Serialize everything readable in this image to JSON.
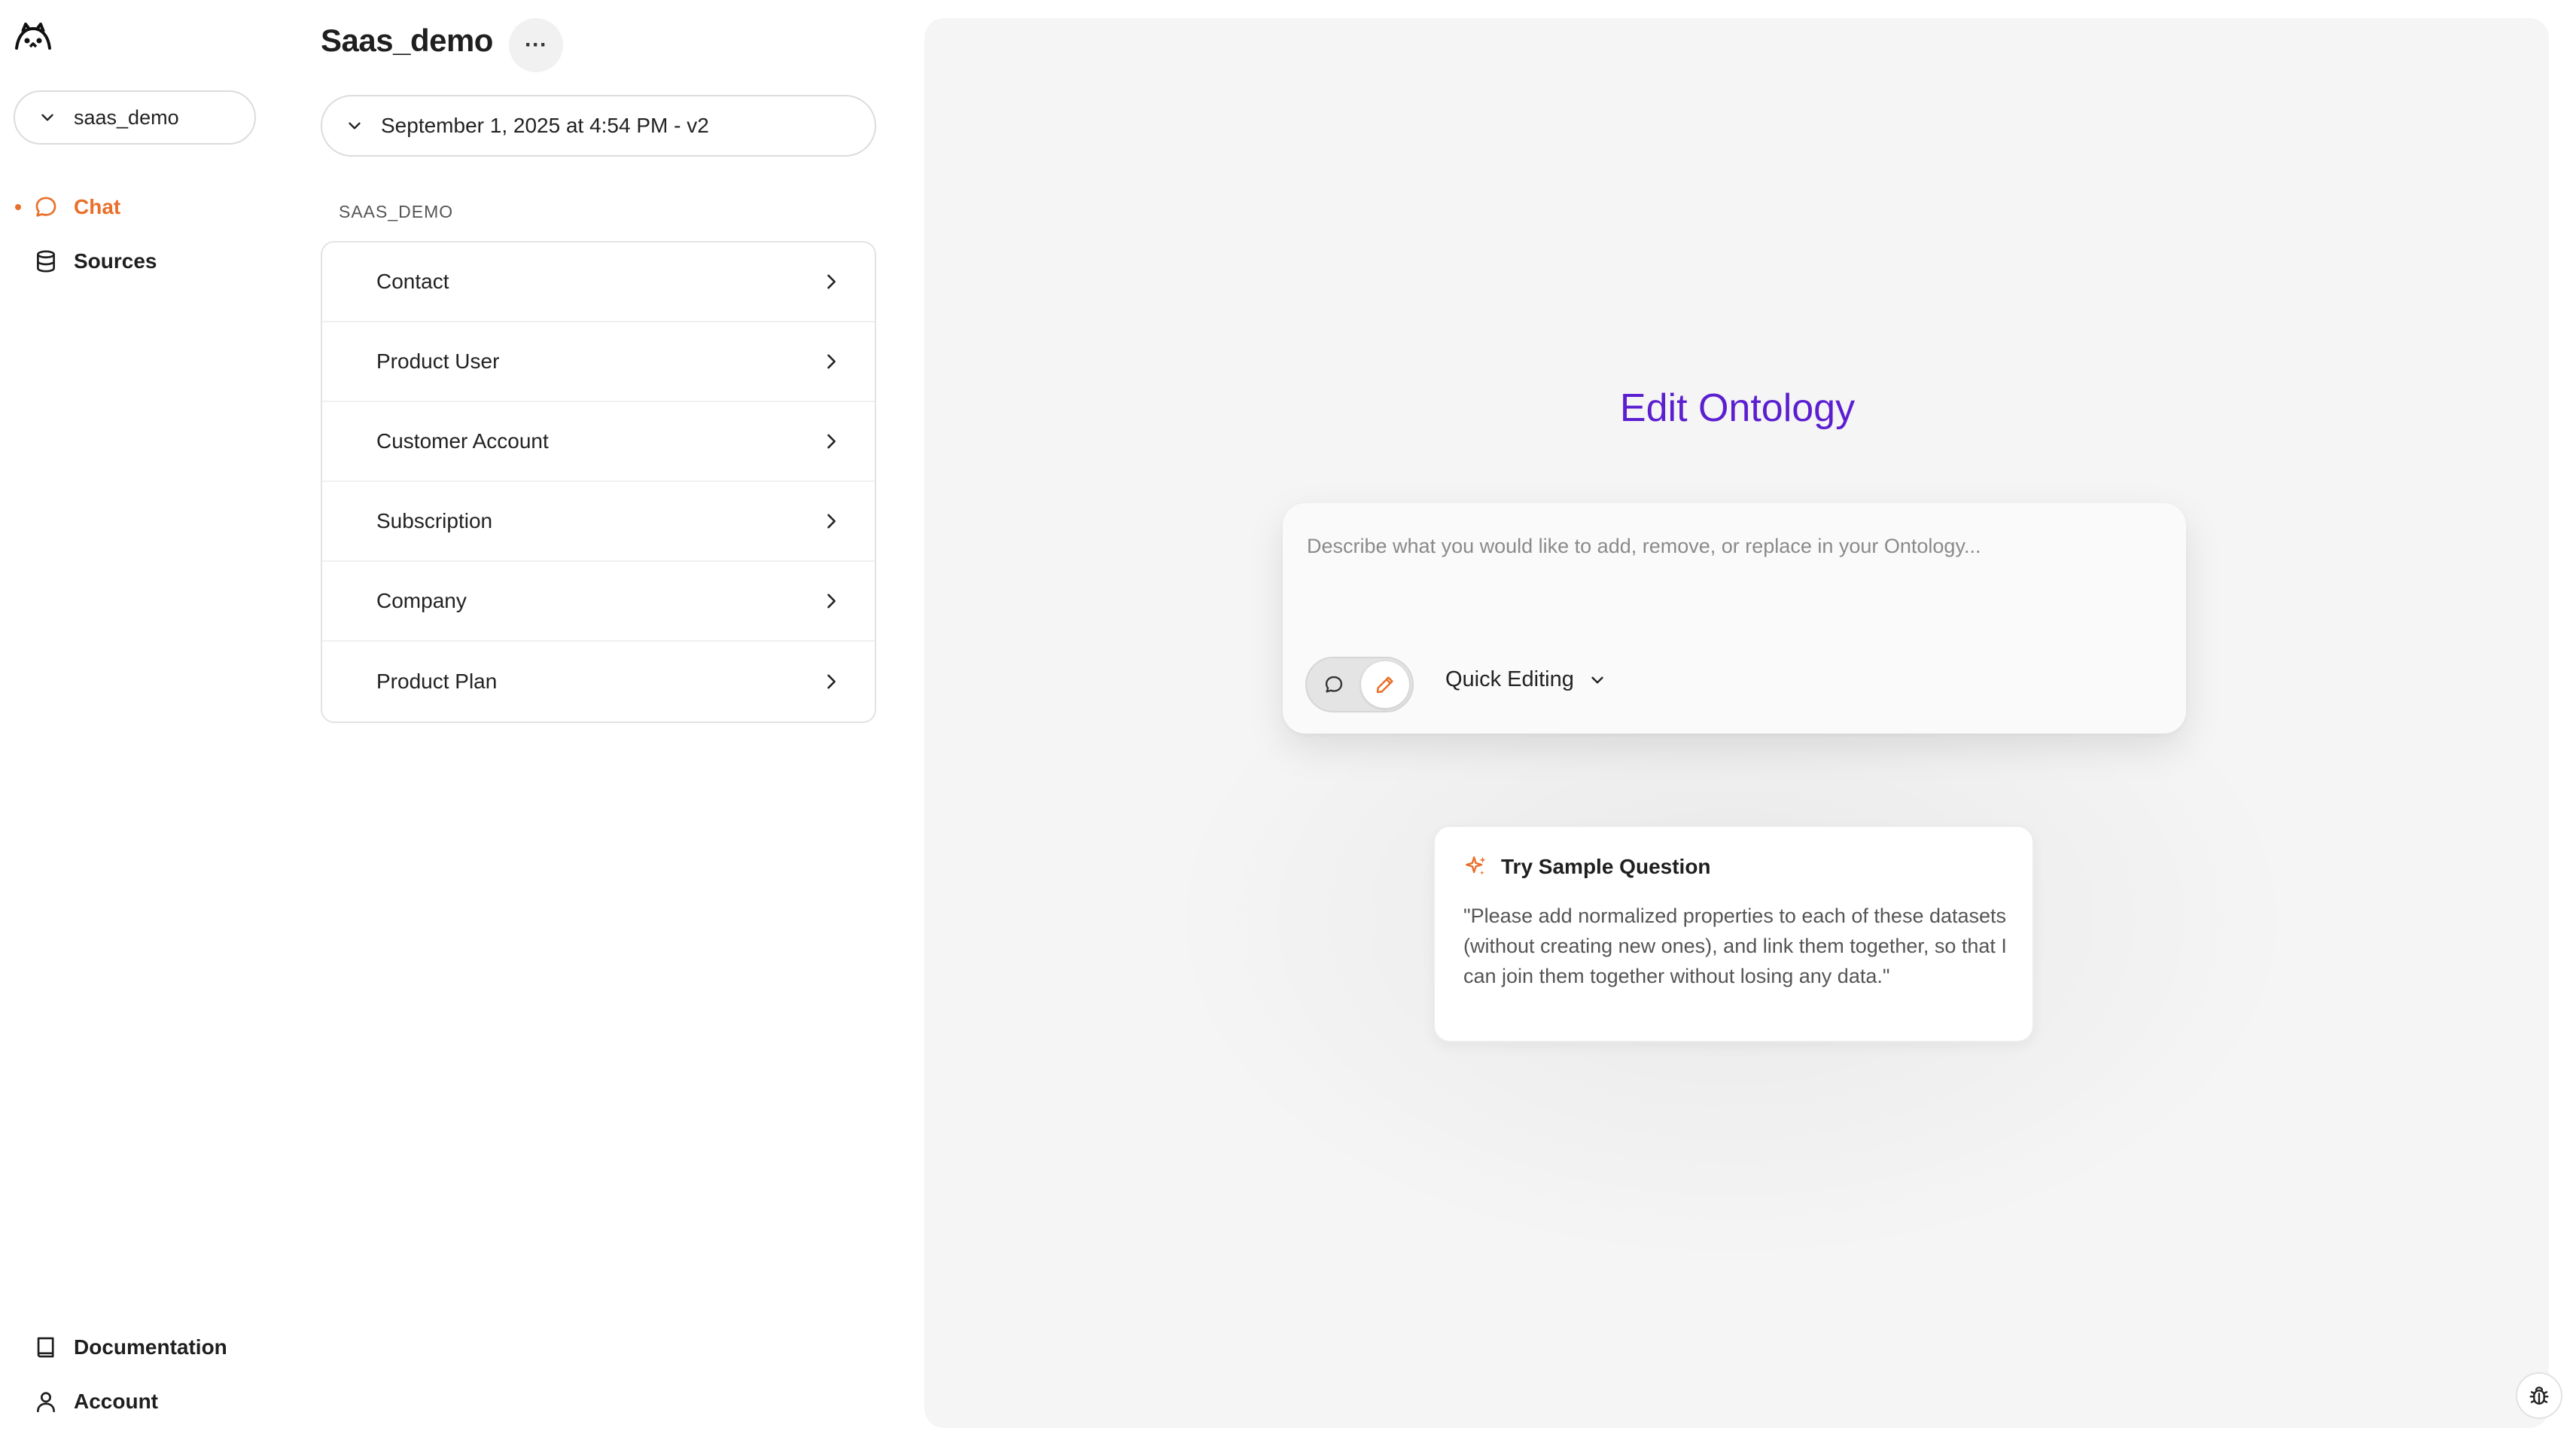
{
  "app": {
    "logo_icon": "cat-face-logo-icon"
  },
  "sidebar": {
    "project_selector": {
      "value": "saas_demo",
      "icon": "chevron-down-icon"
    },
    "nav": [
      {
        "label": "Chat",
        "icon": "chat-bubble-icon",
        "active": true
      },
      {
        "label": "Sources",
        "icon": "database-icon",
        "active": false
      }
    ],
    "footer": [
      {
        "label": "Documentation",
        "icon": "book-icon"
      },
      {
        "label": "Account",
        "icon": "user-icon"
      }
    ],
    "accent_color": "#e8702a"
  },
  "project": {
    "title": "Saas_demo",
    "more_label": "···",
    "version": "September 1, 2025 at 4:54 PM - v2",
    "section_label": "SAAS_DEMO",
    "entities": [
      "Contact",
      "Product User",
      "Customer Account",
      "Subscription",
      "Company",
      "Product Plan"
    ]
  },
  "main": {
    "title": "Edit Ontology",
    "title_color": "#5b1fd0",
    "prompt": {
      "placeholder": "Describe what you would like to add, remove, or replace in your Ontology...",
      "mode_selected": "edit",
      "quick_edit_label": "Quick Editing"
    },
    "sample": {
      "heading": "Try Sample Question",
      "text": "\"Please add normalized properties to each of these datasets (without creating new ones), and link them together, so that I can join them together without losing any data.\""
    },
    "bug_icon": "bug-icon"
  }
}
